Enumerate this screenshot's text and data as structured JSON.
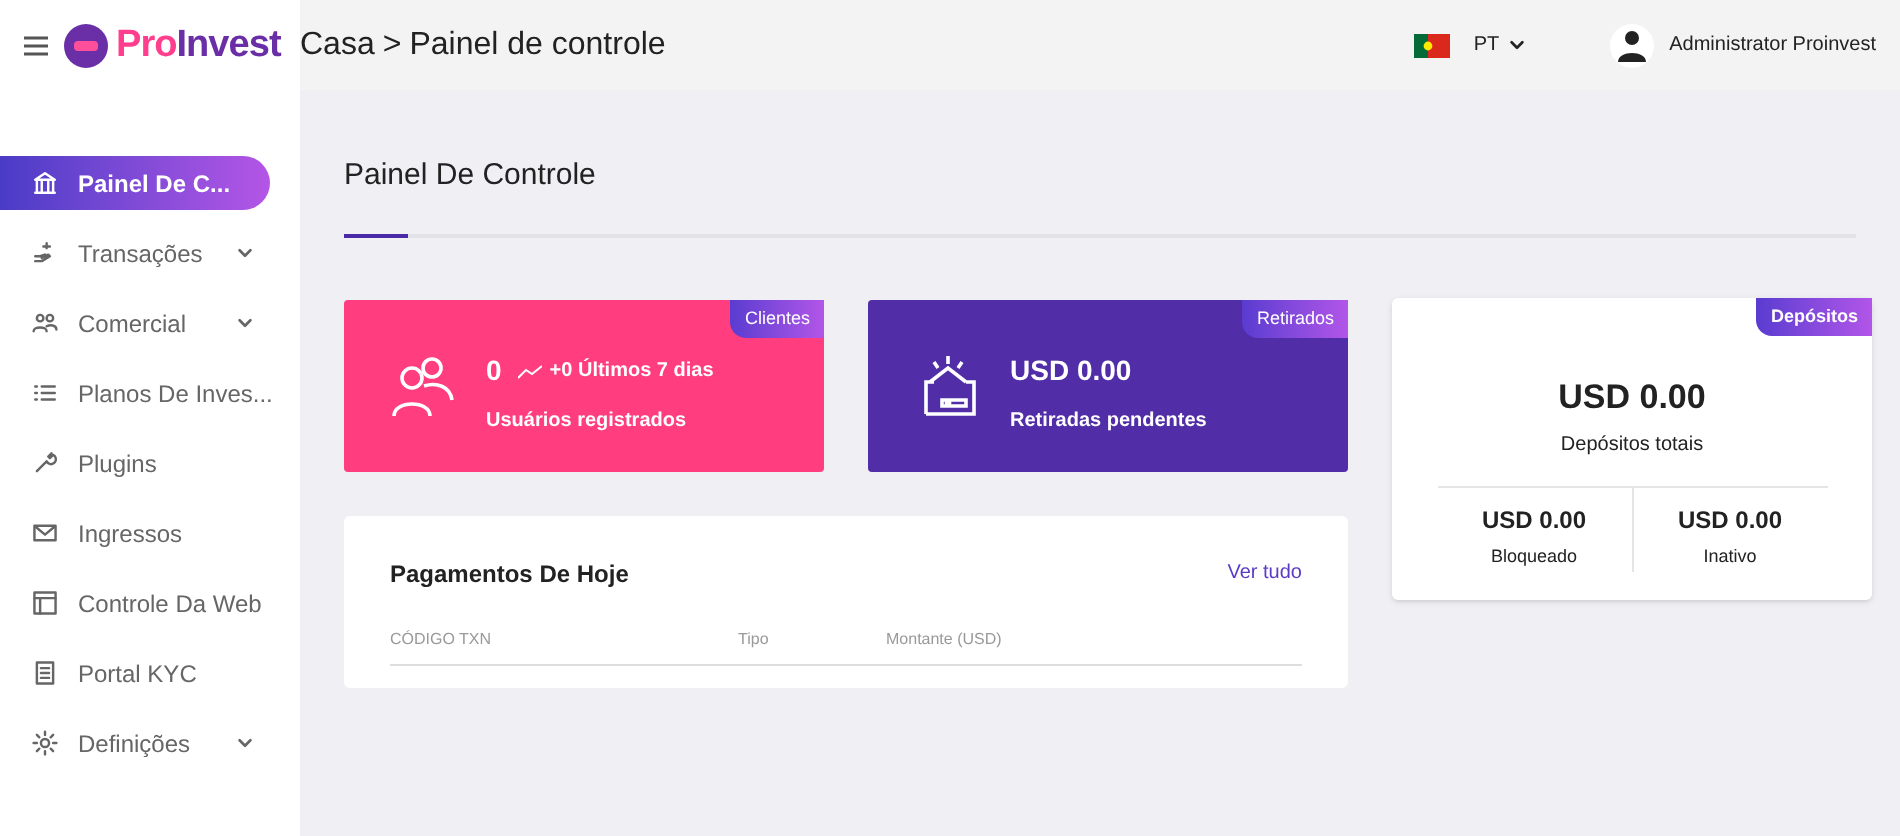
{
  "brand": {
    "name_part1": "Pro",
    "name_part2": "Invest"
  },
  "breadcrumb": {
    "parent": "Casa",
    "separator": ">",
    "current": "Painel de controle"
  },
  "language": {
    "code": "PT"
  },
  "user": {
    "name": "Administrator Proinvest"
  },
  "sidebar": {
    "items": [
      {
        "label": "Painel De C...",
        "selected": true,
        "expandable": false
      },
      {
        "label": "Transações",
        "selected": false,
        "expandable": true
      },
      {
        "label": "Comercial",
        "selected": false,
        "expandable": true
      },
      {
        "label": "Planos De Inves...",
        "selected": false,
        "expandable": false
      },
      {
        "label": "Plugins",
        "selected": false,
        "expandable": false
      },
      {
        "label": "Ingressos",
        "selected": false,
        "expandable": false
      },
      {
        "label": "Controle Da Web",
        "selected": false,
        "expandable": false
      },
      {
        "label": "Portal KYC",
        "selected": false,
        "expandable": false
      },
      {
        "label": "Definições",
        "selected": false,
        "expandable": true
      }
    ]
  },
  "page_title": "Painel De Controle",
  "cards": [
    {
      "kind": "users",
      "badge": "Clientes",
      "value": "0",
      "trend": "+0 Últimos 7 dias",
      "label": "Usuários registrados"
    },
    {
      "kind": "wallet",
      "badge": "Retirados",
      "value": "USD 0.00",
      "label": "Retiradas pendentes"
    }
  ],
  "deposits": {
    "badge": "Depósitos",
    "value": "USD 0.00",
    "label": "Depósitos totais",
    "items": [
      {
        "value": "USD 0.00",
        "label": "Bloqueado"
      },
      {
        "value": "USD 0.00",
        "label": "Inativo"
      }
    ]
  },
  "payments": {
    "title": "Pagamentos De Hoje",
    "link": "Ver tudo",
    "columns": [
      "CÓDIGO TXN",
      "Tipo",
      "Montante (USD)"
    ]
  }
}
